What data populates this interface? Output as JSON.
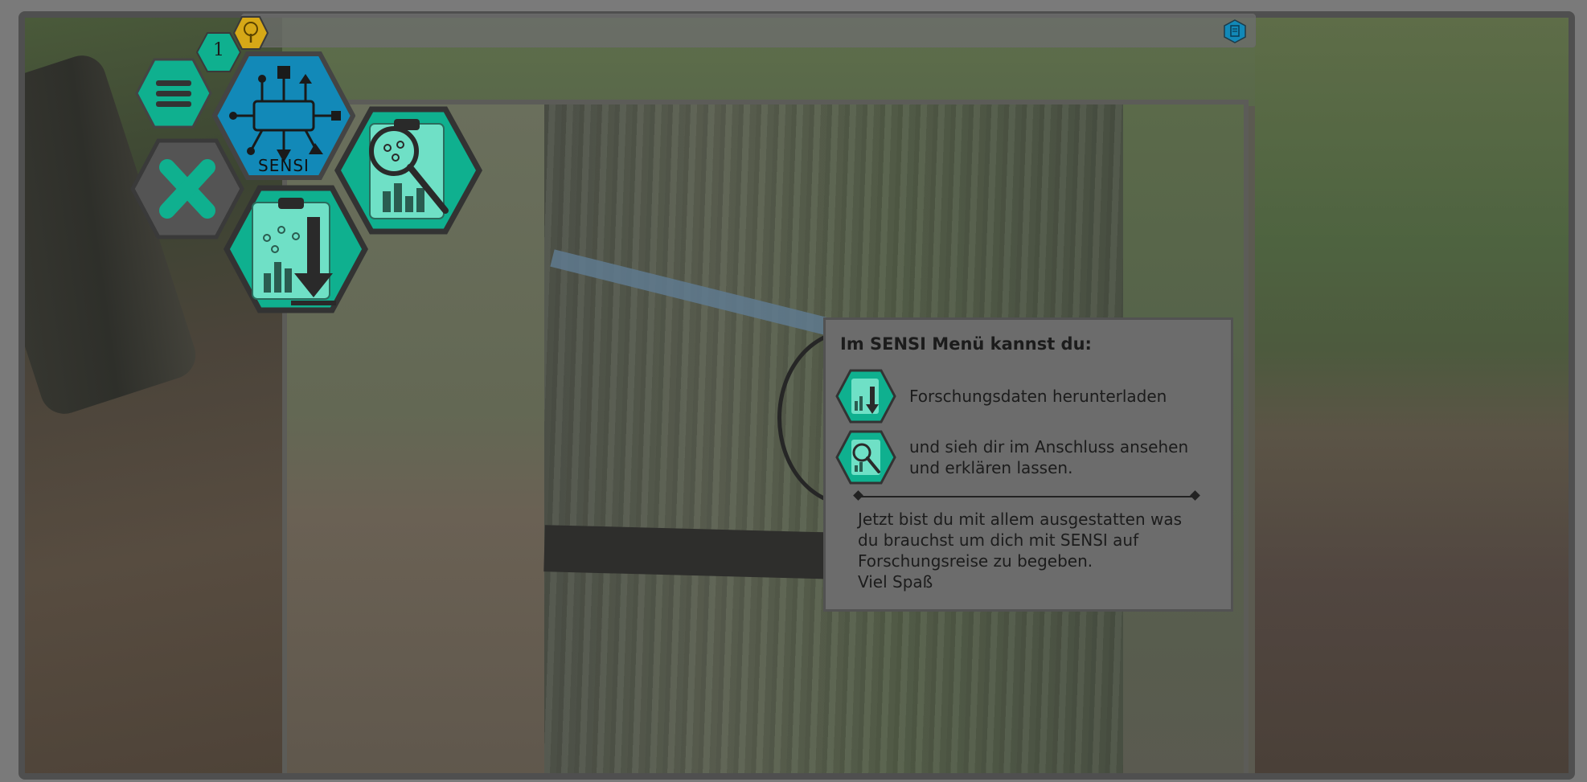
{
  "app": {
    "name": "SENSI",
    "notification_count": "1"
  },
  "colors": {
    "teal": "#0fb08f",
    "teal_light": "#6fe0c6",
    "blue": "#1289b8",
    "gold": "#d6a817",
    "dark_gray": "#444444",
    "close_gray": "#545454",
    "panel_bg": "#6c6c6c"
  },
  "menu": {
    "hamburger_icon": "menu-icon",
    "close_icon": "close-icon",
    "sensi_label": "SENSI",
    "download_icon": "download-data-icon",
    "analyze_icon": "analyze-data-icon",
    "tree_icon": "tree-icon",
    "doc_icon": "document-icon"
  },
  "info_panel": {
    "title": "Im SENSI Menü kannst du:",
    "items": [
      {
        "icon": "download-data-icon",
        "text": "Forschungsdaten herunterladen"
      },
      {
        "icon": "analyze-data-icon",
        "text": "und sieh dir im Anschluss ansehen\nund erklären lassen."
      }
    ],
    "outro": "Jetzt bist du mit allem ausgestatten was\ndu brauchst um dich mit SENSI auf\nForschungsreise zu begeben.\nViel Spaß"
  }
}
